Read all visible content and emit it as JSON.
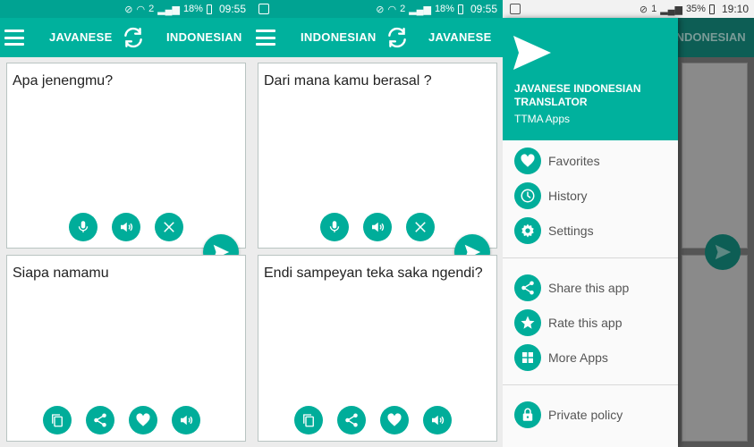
{
  "screens": [
    {
      "status": {
        "percent": "18%",
        "sim": "2",
        "time": "09:55"
      },
      "toolbar": {
        "source_lang": "JAVANESE",
        "target_lang": "INDONESIAN"
      },
      "input_text": "Apa jenengmu?",
      "output_text": "Siapa namamu"
    },
    {
      "status": {
        "percent": "18%",
        "sim": "2",
        "time": "09:55"
      },
      "toolbar": {
        "source_lang": "INDONESIAN",
        "target_lang": "JAVANESE"
      },
      "input_text": "Dari mana kamu berasal ?",
      "output_text": "Endi sampeyan teka saka ngendi?"
    }
  ],
  "drawer_screen": {
    "status": {
      "percent": "35%",
      "sim": "1",
      "time": "19:10"
    },
    "behind_lang": "INDONESIAN",
    "app_title": "JAVANESE INDONESIAN TRANSLATOR",
    "developer": "TTMA Apps",
    "items": [
      {
        "label": "Favorites",
        "icon": "heart-icon"
      },
      {
        "label": "History",
        "icon": "clock-icon"
      },
      {
        "label": "Settings",
        "icon": "gear-icon"
      },
      {
        "label": "Share this app",
        "icon": "share-icon"
      },
      {
        "label": "Rate this app",
        "icon": "star-icon"
      },
      {
        "label": "More Apps",
        "icon": "grid-icon"
      },
      {
        "label": "Private policy",
        "icon": "lock-icon"
      }
    ]
  },
  "colors": {
    "primary": "#00b19d",
    "status_bar": "#00a392",
    "button": "#00ad9a",
    "drawer_dim": "#555555"
  }
}
